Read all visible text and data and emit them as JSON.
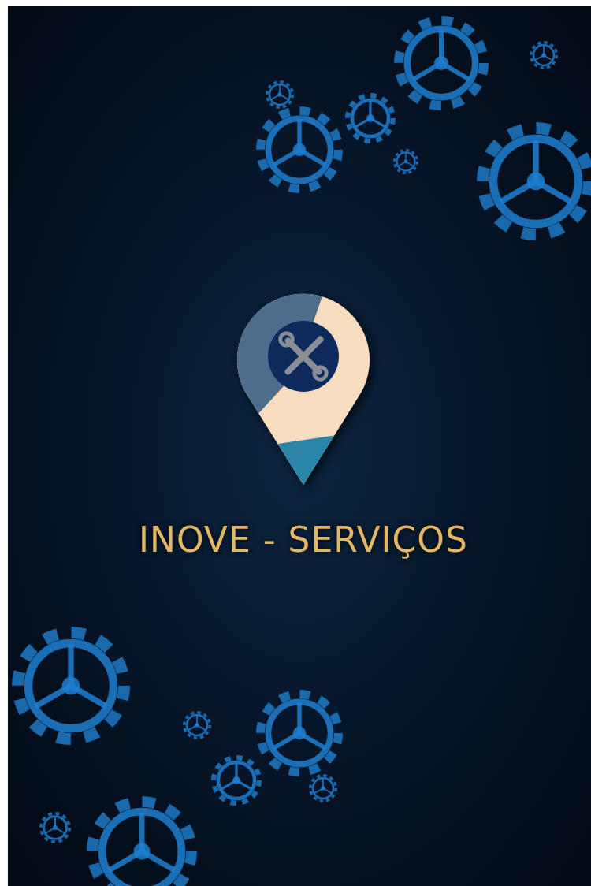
{
  "title": "INOVE - SERVIÇOS"
}
